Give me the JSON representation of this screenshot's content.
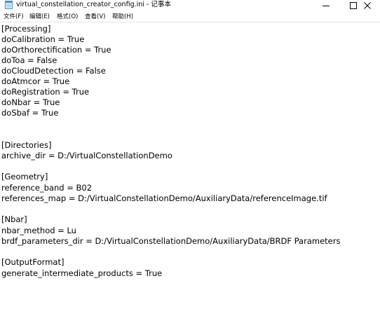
{
  "window": {
    "title": "virtual_constellation_creator_config.ini - 记事本",
    "buttons": {
      "minimize": "minimize-icon",
      "maximize": "maximize-icon",
      "close": "close-icon"
    }
  },
  "menu": {
    "items": [
      {
        "label": "文件(F)"
      },
      {
        "label": "编辑(E)"
      },
      {
        "label": "格式(O)"
      },
      {
        "label": "查看(V)"
      },
      {
        "label": "帮助(H)"
      }
    ]
  },
  "editor": {
    "lines": [
      "[Processing]",
      "doCalibration = True",
      "doOrthorectification = True",
      "doToa = False",
      "doCloudDetection = False",
      "doAtmcor = True",
      "doRegistration = True",
      "doNbar = True",
      "doSbaf = True",
      "",
      "",
      "[Directories]",
      "archive_dir = D:/VirtualConstellationDemo",
      "",
      "[Geometry]",
      "reference_band = B02",
      "references_map = D:/VirtualConstellationDemo/AuxiliaryData/referenceImage.tif",
      "",
      "[Nbar]",
      "nbar_method = Lu",
      "brdf_parameters_dir = D:/VirtualConstellationDemo/AuxiliaryData/BRDF Parameters",
      "",
      "[OutputFormat]",
      "generate_intermediate_products = True"
    ]
  }
}
